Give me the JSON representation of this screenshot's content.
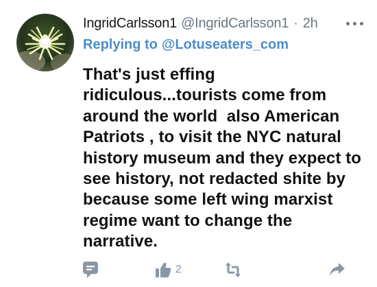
{
  "tweet": {
    "display_name": "IngridCarlsson1",
    "handle": "@IngridCarlsson1",
    "separator": "·",
    "time": "2h",
    "reply_prefix": "Replying to",
    "reply_to": "@Lotuseaters_com",
    "body_lines": [
      "That's just effing",
      "ridiculous...tourists come from",
      "around the world  also American",
      "Patriots , to visit the NYC natural",
      "history museum and they expect to",
      "see history, not redacted shite by",
      "because some left wing marxist",
      "regime want to change the",
      "narrative."
    ]
  },
  "actions": {
    "like_count": "2"
  },
  "icons": [
    "avatar-image",
    "more-icon",
    "comment-icon",
    "like-icon",
    "retweet-icon",
    "share-icon"
  ],
  "colors": {
    "link": "#4d8cc8",
    "muted": "#6a7680",
    "icon": "#8899a6"
  }
}
